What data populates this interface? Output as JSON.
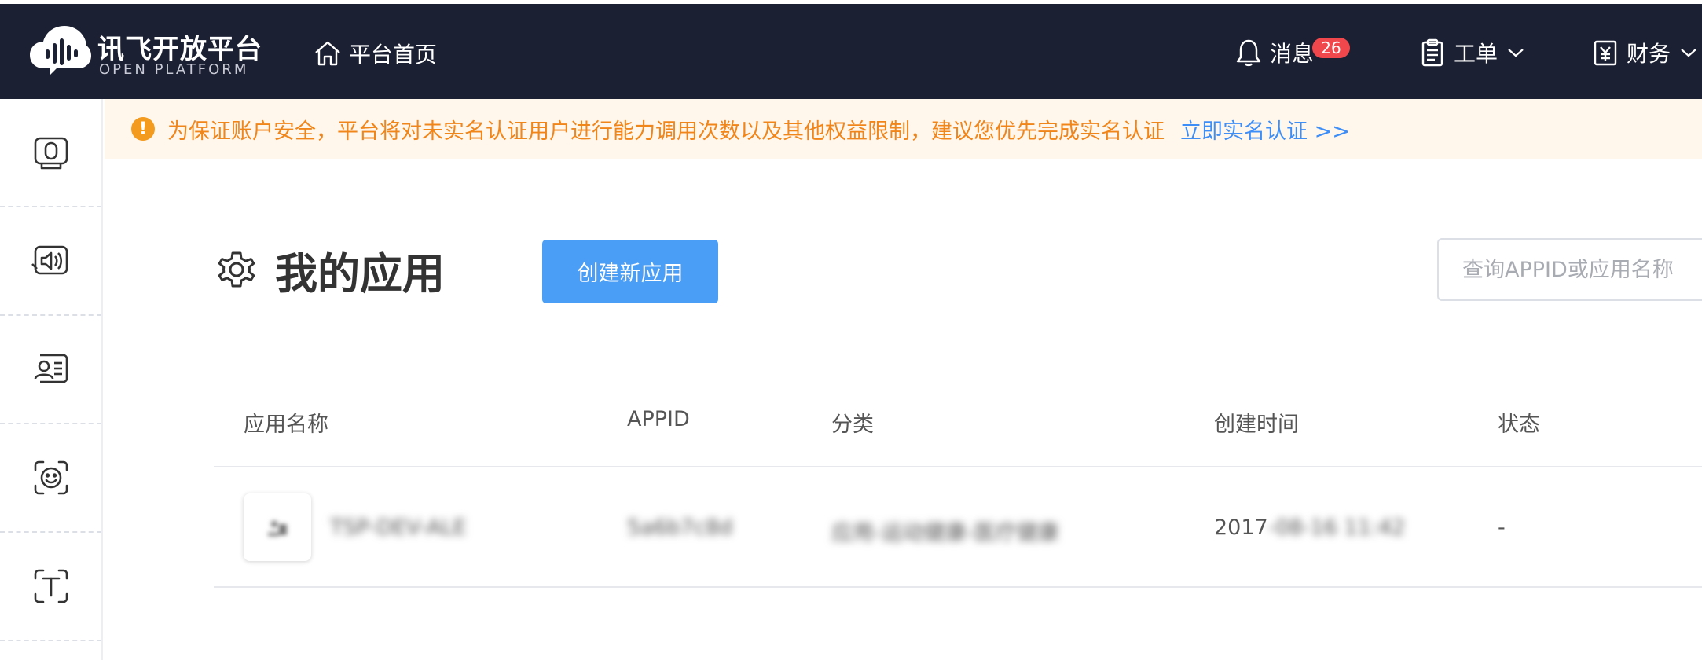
{
  "header": {
    "logo_title": "讯飞开放平台",
    "logo_subtitle": "OPEN PLATFORM",
    "home_label": "平台首页",
    "messages_label": "消息",
    "messages_count": "26",
    "ticket_label": "工单",
    "finance_label": "财务"
  },
  "sidebar": {
    "items": [
      {
        "icon": "voice-recognition-icon"
      },
      {
        "icon": "speech-synthesis-icon"
      },
      {
        "icon": "voice-interaction-icon"
      },
      {
        "icon": "face-recognition-icon"
      },
      {
        "icon": "text-recognition-icon"
      }
    ]
  },
  "notice": {
    "text": "为保证账户安全，平台将对未实名认证用户进行能力调用次数以及其他权益限制，建议您优先完成实名认证",
    "link": "立即实名认证 >>"
  },
  "main": {
    "title": "我的应用",
    "create_button": "创建新应用",
    "search_placeholder": "查询APPID或应用名称"
  },
  "table": {
    "headers": [
      "应用名称",
      "APPID",
      "分类",
      "创建时间",
      "状态"
    ],
    "rows": [
      {
        "name": "TSP-DEV-ALE",
        "appid": "5a6b7c8d",
        "category": "应用-运动健康-医疗健康",
        "created": "2017-08-16 11:42",
        "created_prefix": "2017",
        "status": "-"
      }
    ]
  },
  "colors": {
    "header_bg": "#1c2033",
    "accent": "#4a9ef6",
    "badge": "#f0474d",
    "notice_text": "#f0851a",
    "notice_bg": "#fff6ec",
    "link": "#3e8ef7"
  }
}
